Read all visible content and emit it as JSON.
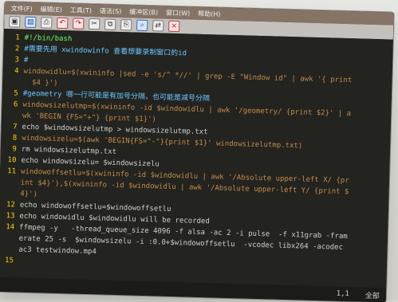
{
  "menu": {
    "items": [
      "文件(F)",
      "编辑(E)",
      "工具(T)",
      "语法(S)",
      "缓冲区(B)",
      "窗口(W)",
      "帮助(H)"
    ]
  },
  "toolbar": {
    "icons": [
      "open-icon",
      "save-icon",
      "print-icon",
      "undo-icon",
      "redo-icon",
      "cut-icon",
      "copy-icon",
      "paste-icon",
      "find-icon",
      "replace-icon",
      "close-icon"
    ]
  },
  "editor": {
    "lines": [
      {
        "n": "1",
        "t": "#!/bin/bash"
      },
      {
        "n": "2",
        "t": "#需要先用 xwindowinfo 查看想要录制窗口的id"
      },
      {
        "n": "3",
        "t": "#"
      },
      {
        "n": "4",
        "t": "windowidlu=$(xwininfo |sed -e 's/^ *//' | grep -E \"Window id\" | awk '{ print"
      },
      {
        "n": "",
        "t": "  $4 }')"
      },
      {
        "n": "5",
        "t": "#geometry 哪一行可能是有加号分隔，也可能是减号分隔"
      },
      {
        "n": "6",
        "t": "windowsizelutmp=$(xwininfo -id $windowidlu | awk '/geometry/ {print $2}' | a"
      },
      {
        "n": "",
        "t": "wk 'BEGIN {FS=\"+\"} {print $1}')"
      },
      {
        "n": "7",
        "t": "echo $windowsizelutmp > windowsizelutmp.txt"
      },
      {
        "n": "8",
        "t": "windowsizelu=$(awk 'BEGIN{FS=\"-\"}{print $1}' windowsizelutmp.txt)"
      },
      {
        "n": "9",
        "t": "rm windowsizelutmp.txt"
      },
      {
        "n": "10",
        "t": "echo windowsizelu= $windowsizelu"
      },
      {
        "n": "11",
        "t": "windowoffsetlu=$(xwininfo -id $windowidlu | awk '/Absolute upper-left X/ {pr"
      },
      {
        "n": "",
        "t": "int $4}'),$(xwininfo -id $windowidlu | awk '/Absolute upper-left Y/ {print $"
      },
      {
        "n": "",
        "t": "4}')"
      },
      {
        "n": "12",
        "t": "echo windowoffsetlu=$windowoffsetlu"
      },
      {
        "n": "13",
        "t": "echo windowidlu $windowidlu will be recorded"
      },
      {
        "n": "14",
        "t": "ffmpeg -y   -thread_queue_size 4096 -f alsa -ac 2 -i pulse  -f x11grab -fram"
      },
      {
        "n": "",
        "t": "erate 25 -s  $windowsizelu -i :0.0+$windowoffsetlu  -vcodec libx264 -acodec"
      },
      {
        "n": "",
        "t": "ac3 testwindow.mp4"
      },
      {
        "n": "15",
        "t": ""
      }
    ]
  },
  "status": {
    "position": "1,1",
    "view": "全部"
  }
}
